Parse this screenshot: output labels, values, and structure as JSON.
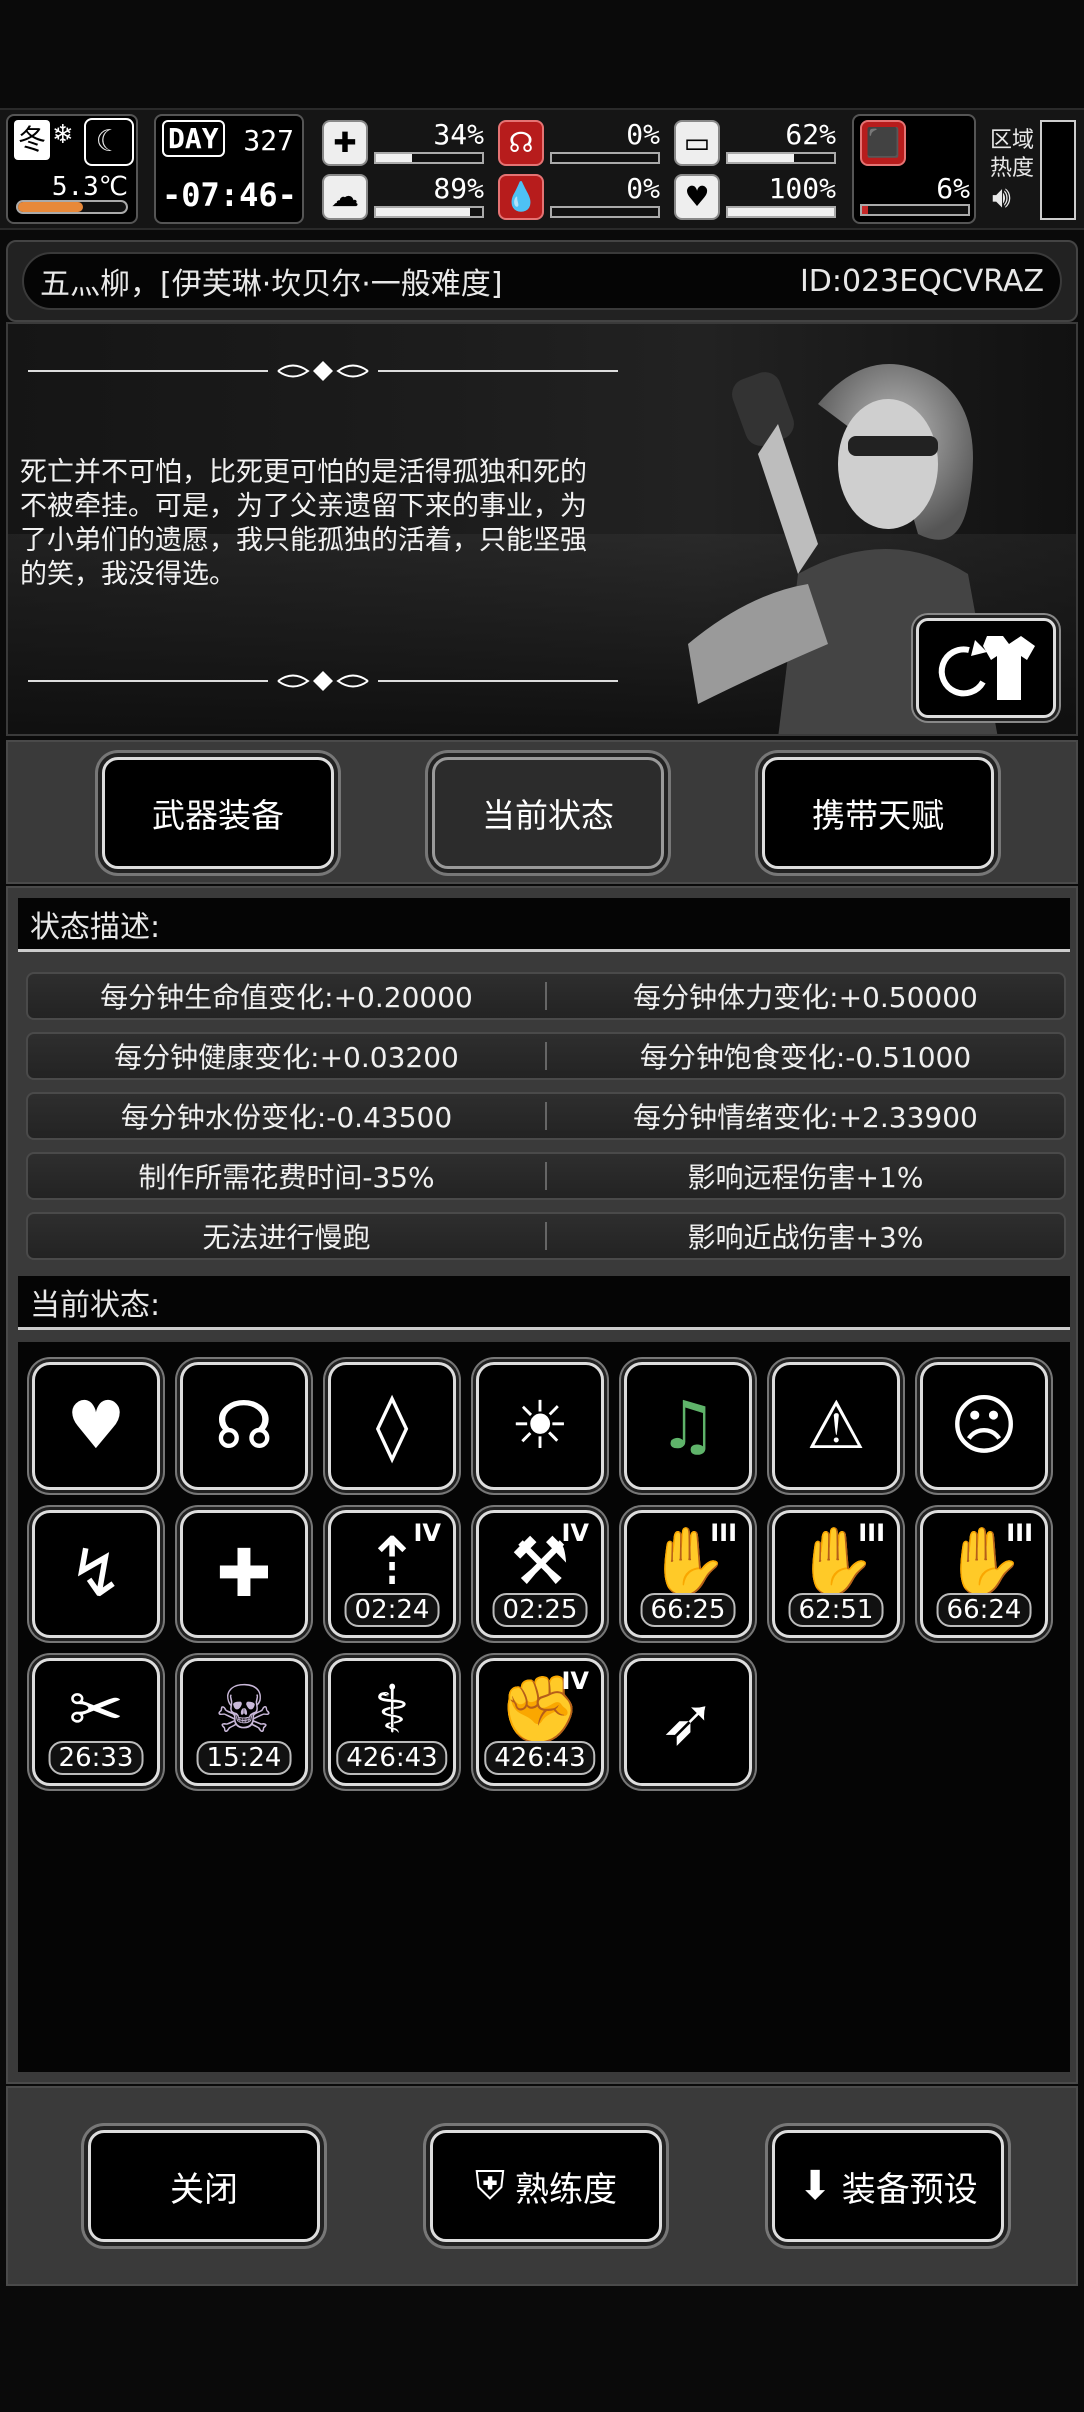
{
  "hud": {
    "season": "冬",
    "temperature": "5.3℃",
    "day_label": "DAY",
    "day_value": "327",
    "clock": "-07:46-",
    "area_heat_label_1": "区域",
    "area_heat_label_2": "热度",
    "stats": [
      {
        "icon": "medkit-icon",
        "value": "34%",
        "fraction": 0.34
      },
      {
        "icon": "stomach-icon",
        "value": "0%",
        "fraction": 0.0
      },
      {
        "icon": "water-bottle-icon",
        "value": "62%",
        "fraction": 0.62
      },
      {
        "icon": "brain-icon",
        "value": "89%",
        "fraction": 0.89
      },
      {
        "icon": "blood-drop-icon",
        "value": "0%",
        "fraction": 0.0
      },
      {
        "icon": "heart-icon",
        "value": "100%",
        "fraction": 1.0
      },
      {
        "icon": "boot-icon",
        "value": "6%",
        "fraction": 0.06
      }
    ]
  },
  "player": {
    "name_line": "五灬柳，[伊芙琳·坎贝尔·一般难度]",
    "id": "ID:023EQCVRAZ"
  },
  "quote": "死亡并不可怕，比死更可怕的是活得孤独和死的不被牵挂。可是，为了父亲遗留下来的事业，为了小弟们的遗愿，我只能孤独的活着，只能坚强的笑，我没得选。",
  "tabs": [
    "武器装备",
    "当前状态",
    "携带天赋"
  ],
  "active_tab": "当前状态",
  "status_desc_title": "状态描述:",
  "stats_rows": [
    [
      "每分钟生命值变化:+0.20000",
      "每分钟体力变化:+0.50000"
    ],
    [
      "每分钟健康变化:+0.03200",
      "每分钟饱食变化:-0.51000"
    ],
    [
      "每分钟水份变化:-0.43500",
      "每分钟情绪变化:+2.33900"
    ],
    [
      "制作所需花费时间-35%",
      "影响远程伤害+1%"
    ],
    [
      "无法进行慢跑",
      "影响近战伤害+3%"
    ]
  ],
  "current_status_title": "当前状态:",
  "status_icons": [
    {
      "name": "heart-status-icon",
      "glyph": "♥",
      "roman": "",
      "timer": ""
    },
    {
      "name": "stomach-status-icon",
      "glyph": "☊",
      "roman": "",
      "timer": ""
    },
    {
      "name": "water-drop-status-icon",
      "glyph": "◊",
      "roman": "",
      "timer": ""
    },
    {
      "name": "sun-status-icon",
      "glyph": "☀",
      "roman": "",
      "timer": ""
    },
    {
      "name": "music-heart-status-icon",
      "glyph": "♫",
      "roman": "",
      "timer": ""
    },
    {
      "name": "alarm-person-status-icon",
      "glyph": "⚠",
      "roman": "",
      "timer": ""
    },
    {
      "name": "head-status-icon",
      "glyph": "☹",
      "roman": "",
      "timer": ""
    },
    {
      "name": "running-status-icon",
      "glyph": "↯",
      "roman": "",
      "timer": ""
    },
    {
      "name": "medicine-status-icon",
      "glyph": "✚",
      "roman": "",
      "timer": ""
    },
    {
      "name": "drink-buff-status-icon",
      "glyph": "⇡",
      "roman": "IV",
      "timer": "02:24"
    },
    {
      "name": "weapon-buff-status-icon",
      "glyph": "⚒",
      "roman": "IV",
      "timer": "02:25"
    },
    {
      "name": "hand-buff-status-icon-1",
      "glyph": "✋",
      "roman": "III",
      "timer": "66:25"
    },
    {
      "name": "hand-buff-status-icon-2",
      "glyph": "✋",
      "roman": "III",
      "timer": "62:51"
    },
    {
      "name": "hand-buff-status-icon-3",
      "glyph": "✋",
      "roman": "III",
      "timer": "66:24"
    },
    {
      "name": "syringe-status-icon",
      "glyph": "✂",
      "roman": "",
      "timer": "26:33"
    },
    {
      "name": "zombie-status-icon",
      "glyph": "☠",
      "roman": "",
      "timer": "15:24"
    },
    {
      "name": "dna-status-icon",
      "glyph": "⚕",
      "roman": "",
      "timer": "426:43"
    },
    {
      "name": "arm-buff-status-icon",
      "glyph": "✊",
      "roman": "IV",
      "timer": "426:43"
    },
    {
      "name": "swift-foot-status-icon",
      "glyph": "➶",
      "roman": "",
      "timer": ""
    }
  ],
  "footer": {
    "close": "关闭",
    "proficiency": "熟练度",
    "equip_preset": "装备预设"
  }
}
